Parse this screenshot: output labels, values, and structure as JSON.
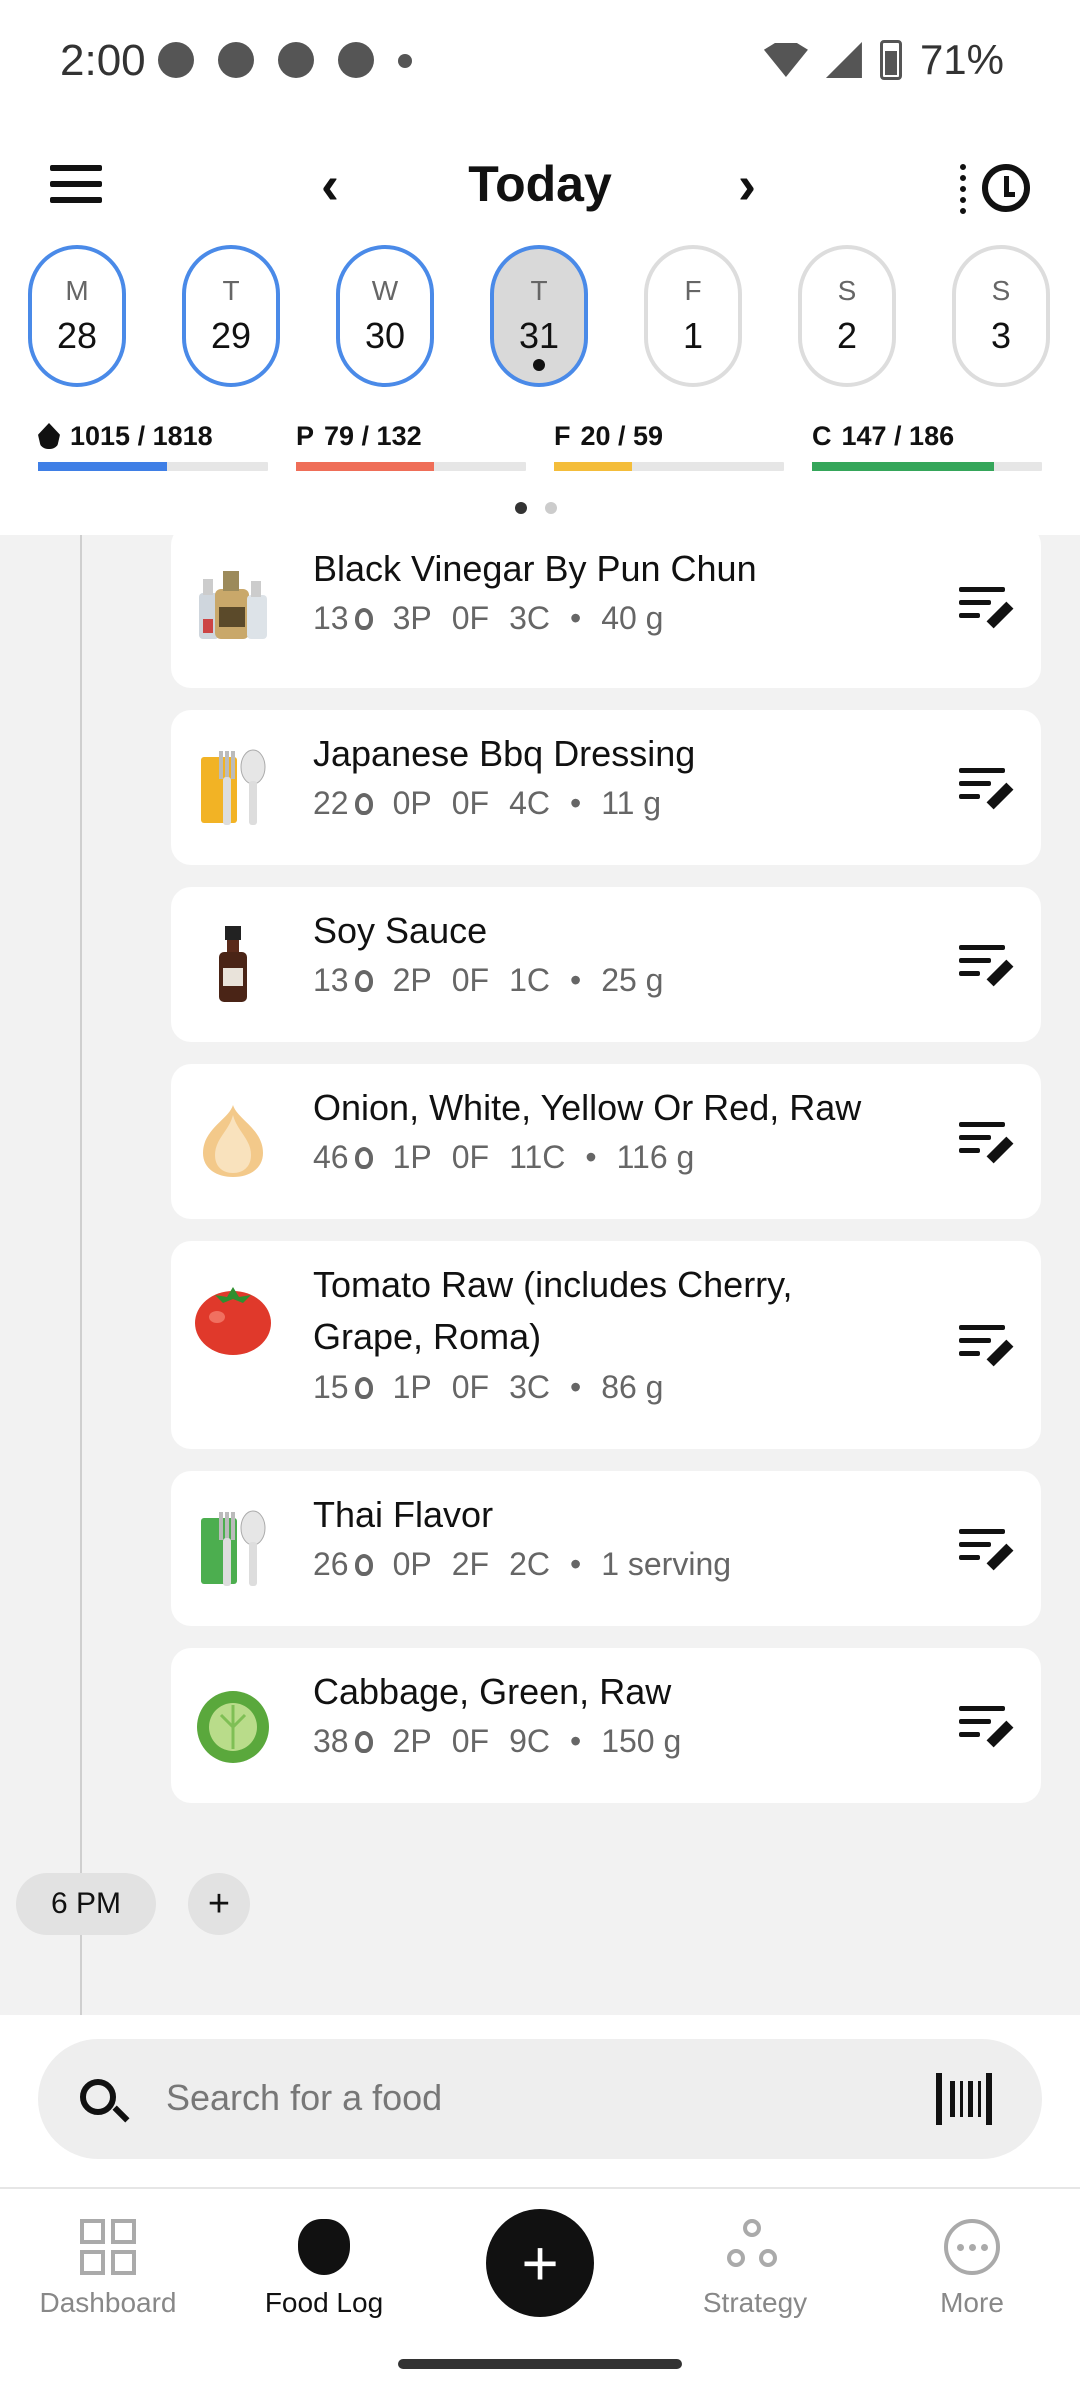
{
  "status": {
    "time": "2:00",
    "battery": "71%"
  },
  "header": {
    "title": "Today",
    "prev": "‹",
    "next": "›"
  },
  "days": [
    {
      "letter": "M",
      "num": "28"
    },
    {
      "letter": "T",
      "num": "29"
    },
    {
      "letter": "W",
      "num": "30"
    },
    {
      "letter": "T",
      "num": "31"
    },
    {
      "letter": "F",
      "num": "1"
    },
    {
      "letter": "S",
      "num": "2"
    },
    {
      "letter": "S",
      "num": "3"
    }
  ],
  "macros": {
    "calories": {
      "label": "1015 / 1818",
      "progress": 0.56,
      "color": "#3f7fe6"
    },
    "protein": {
      "prefix": "P",
      "label": "79 / 132",
      "progress": 0.6,
      "color": "#ef6e58"
    },
    "fat": {
      "prefix": "F",
      "label": "20 / 59",
      "progress": 0.34,
      "color": "#f4bd3a"
    },
    "carbs": {
      "prefix": "C",
      "label": "147 / 186",
      "progress": 0.79,
      "color": "#35a65a"
    }
  },
  "foods": [
    {
      "name": "Black Vinegar By Pun Chun",
      "cal": "13",
      "p": "3P",
      "f": "0F",
      "c": "3C",
      "amount": "40 g"
    },
    {
      "name": "Japanese Bbq Dressing",
      "cal": "22",
      "p": "0P",
      "f": "0F",
      "c": "4C",
      "amount": "11 g"
    },
    {
      "name": "Soy Sauce",
      "cal": "13",
      "p": "2P",
      "f": "0F",
      "c": "1C",
      "amount": "25 g"
    },
    {
      "name": "Onion, White, Yellow Or Red, Raw",
      "cal": "46",
      "p": "1P",
      "f": "0F",
      "c": "11C",
      "amount": "116 g"
    },
    {
      "name": "Tomato Raw (includes Cherry, Grape, Roma)",
      "cal": "15",
      "p": "1P",
      "f": "0F",
      "c": "3C",
      "amount": "86 g"
    },
    {
      "name": "Thai Flavor",
      "cal": "26",
      "p": "0P",
      "f": "2F",
      "c": "2C",
      "amount": "1 serving"
    },
    {
      "name": "Cabbage, Green, Raw",
      "cal": "38",
      "p": "2P",
      "f": "0F",
      "c": "9C",
      "amount": "150 g"
    }
  ],
  "time_chip": "6 PM",
  "add_chip": "+",
  "search": {
    "placeholder": "Search for a food"
  },
  "nav": {
    "dashboard": "Dashboard",
    "food_log": "Food Log",
    "fab": "+",
    "strategy": "Strategy",
    "more": "More"
  },
  "bullet": "•"
}
